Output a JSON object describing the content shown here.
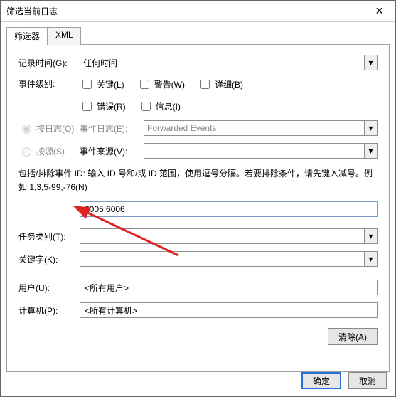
{
  "window": {
    "title": "筛选当前日志"
  },
  "tabs": {
    "filter": "筛选器",
    "xml": "XML"
  },
  "labels": {
    "recordTime": "记录时间(G):",
    "eventLevel": "事件级别:",
    "byLog": "按日志(O)",
    "bySource": "按源(S)",
    "eventLog": "事件日志(E):",
    "eventSource": "事件来源(V):",
    "hint": "包括/排除事件 ID: 输入 ID 号和/或 ID 范围，使用逗号分隔。若要排除条件，请先键入减号。例如 1,3,5-99,-76(N)",
    "taskCategory": "任务类别(T):",
    "keywords": "关键字(K):",
    "user": "用户(U):",
    "computer": "计算机(P):"
  },
  "fields": {
    "recordTime": "任何时间",
    "eventLog": "Forwarded Events",
    "eventSource": "",
    "eventIds": "6005,6006",
    "taskCategory": "",
    "keywords": "",
    "user": "<所有用户>",
    "computer": "<所有计算机>"
  },
  "checks": {
    "critical": "关键(L)",
    "warning": "警告(W)",
    "verbose": "详细(B)",
    "error": "错误(R)",
    "info": "信息(I)"
  },
  "buttons": {
    "clear": "清除(A)",
    "ok": "确定",
    "cancel": "取消"
  }
}
